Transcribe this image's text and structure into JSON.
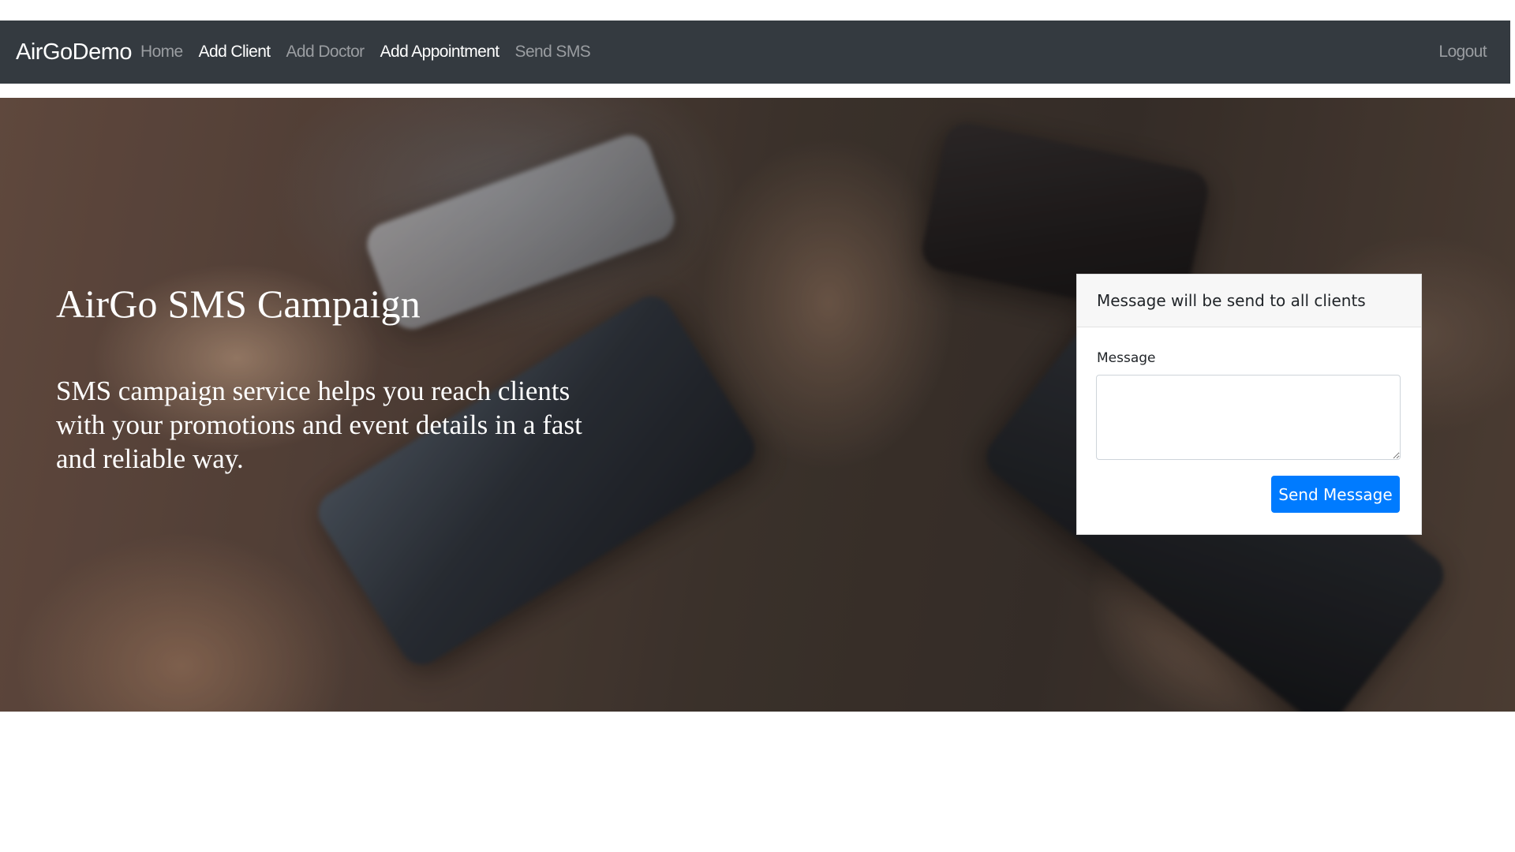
{
  "navbar": {
    "brand": "AirGoDemo",
    "links": [
      {
        "label": "Home",
        "active": false
      },
      {
        "label": "Add Client",
        "active": true
      },
      {
        "label": "Add Doctor",
        "active": false
      },
      {
        "label": "Add Appointment",
        "active": true
      },
      {
        "label": "Send SMS",
        "active": false
      }
    ],
    "logout_label": "Logout"
  },
  "hero": {
    "title": "AirGo SMS Campaign",
    "description": "SMS campaign service helps you reach clients with your promotions and event details in a fast and reliable way."
  },
  "sms_card": {
    "header": "Message will be send to all clients",
    "message_label": "Message",
    "message_value": "",
    "send_button_label": "Send Message"
  },
  "colors": {
    "navbar_bg": "#343a40",
    "nav_link_active": "#ffffff",
    "nav_link_inactive": "#9a9da1",
    "button_primary": "#007bff"
  }
}
